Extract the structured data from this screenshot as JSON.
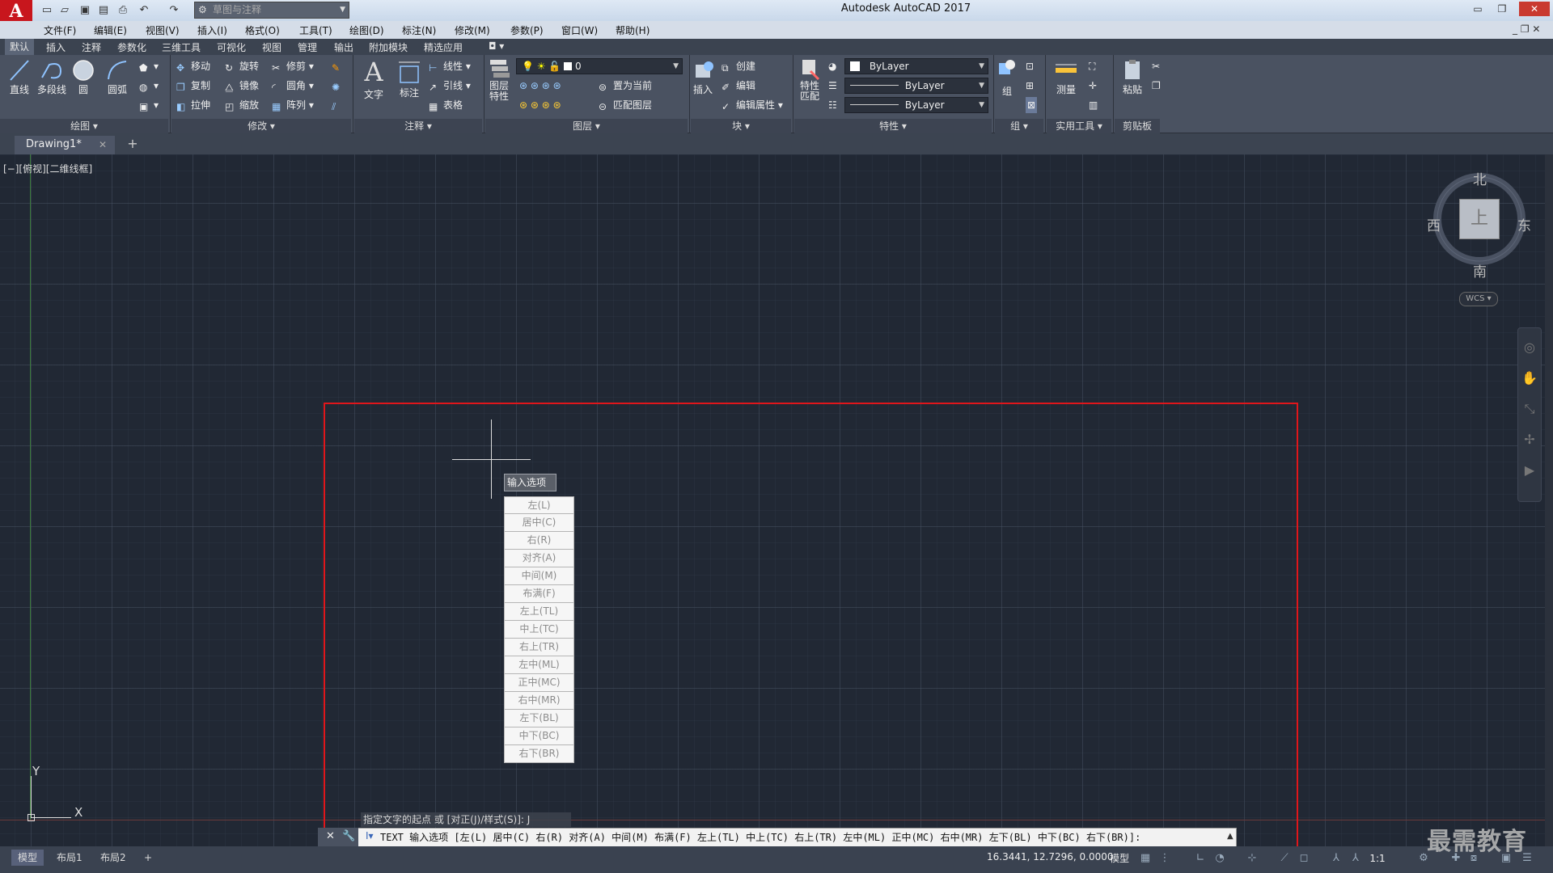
{
  "title_bar": {
    "logo": "A",
    "workspace": "草图与注释",
    "title": "Autodesk AutoCAD 2017"
  },
  "menu": [
    "文件(F)",
    "编辑(E)",
    "视图(V)",
    "插入(I)",
    "格式(O)",
    "工具(T)",
    "绘图(D)",
    "标注(N)",
    "修改(M)",
    "参数(P)",
    "窗口(W)",
    "帮助(H)"
  ],
  "ribbon_tabs": [
    "默认",
    "插入",
    "注释",
    "参数化",
    "三维工具",
    "可视化",
    "视图",
    "管理",
    "输出",
    "附加模块",
    "精选应用"
  ],
  "draw_panel": {
    "tools": [
      "直线",
      "多段线",
      "圆",
      "圆弧"
    ],
    "footer": "绘图 ▾"
  },
  "modify_panel": {
    "row1": [
      "移动",
      "旋转",
      "修剪"
    ],
    "row2": [
      "复制",
      "镜像",
      "圆角"
    ],
    "row3": [
      "拉伸",
      "缩放",
      "阵列"
    ],
    "footer": "修改 ▾"
  },
  "annotation_panel": {
    "text": "文字",
    "dim": "标注",
    "linear": "线性",
    "leader": "引线",
    "table": "表格",
    "footer": "注释 ▾"
  },
  "layer_panel": {
    "props": "图层\n特性",
    "layer_value": "0",
    "set_current": "置为当前",
    "match": "匹配图层",
    "footer": "图层 ▾"
  },
  "block_panel": {
    "insert": "插入",
    "create": "创建",
    "edit": "编辑",
    "edit_attr": "编辑属性",
    "footer": "块 ▾"
  },
  "props_panel": {
    "match": "特性\n匹配",
    "color": "ByLayer",
    "linetype": "ByLayer",
    "lineweight": "ByLayer",
    "footer": "特性 ▾"
  },
  "group_panel": {
    "group": "组",
    "footer": "组 ▾"
  },
  "util_panel": {
    "measure": "测量",
    "footer": "实用工具 ▾"
  },
  "clip_panel": {
    "paste": "粘贴",
    "footer": "剪贴板"
  },
  "doc_tab": {
    "name": "Drawing1*",
    "close": "✕",
    "add": "+"
  },
  "viewport_label": "[−][俯视][二维线框]",
  "viewcube": {
    "north": "北",
    "south": "南",
    "east": "东",
    "west": "西",
    "face": "上",
    "wcs": "WCS"
  },
  "tooltip": "输入选项",
  "options": [
    "左(L)",
    "居中(C)",
    "右(R)",
    "对齐(A)",
    "中间(M)",
    "布满(F)",
    "左上(TL)",
    "中上(TC)",
    "右上(TR)",
    "左中(ML)",
    "正中(MC)",
    "右中(MR)",
    "左下(BL)",
    "中下(BC)",
    "右下(BR)"
  ],
  "ucs": {
    "x": "X",
    "y": "Y"
  },
  "command": {
    "history": "指定文字的起点 或 [对正(J)/样式(S)]: J",
    "prefix": "I▾",
    "line": "TEXT 输入选项 [左(L) 居中(C) 右(R) 对齐(A) 中间(M) 布满(F) 左上(TL) 中上(TC) 右上(TR) 左中(ML) 正中(MC) 右中(MR) 左下(BL) 中下(BC) 右下(BR)]:"
  },
  "layout_tabs": [
    "模型",
    "布局1",
    "布局2",
    "+"
  ],
  "status": {
    "coords": "16.3441, 12.7296, 0.0000",
    "model": "模型",
    "scale": "1:1"
  },
  "watermark": "最需教育"
}
